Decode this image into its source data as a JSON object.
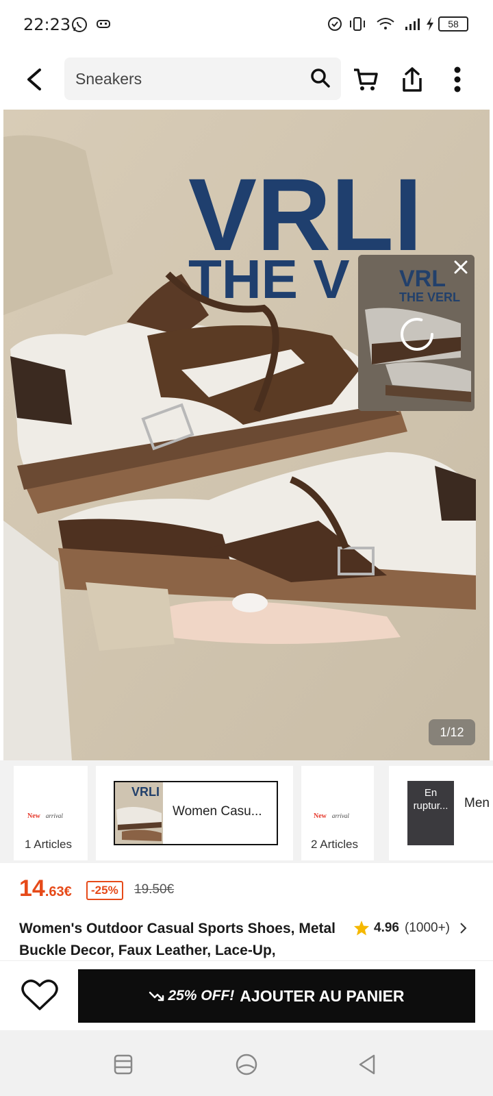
{
  "status_bar": {
    "time": "22:23",
    "battery": "58"
  },
  "header": {
    "search_value": "Sneakers",
    "icons": [
      "back-arrow-icon",
      "search-icon",
      "cart-icon",
      "share-icon",
      "more-vertical-icon"
    ]
  },
  "gallery": {
    "counter": "1/12",
    "shirt_text_line1": "VRLI",
    "shirt_text_line2": "THE V",
    "mini_player_text1": "VRL",
    "mini_player_text2": "THE VERL"
  },
  "variants": [
    {
      "type": "new-arrival",
      "badge_new": "New",
      "badge_arrival": "arrival",
      "label": "1 Articles"
    },
    {
      "type": "selected",
      "title": "Women Casu...",
      "thumb_text": "VRL"
    },
    {
      "type": "new-arrival",
      "badge_new": "New",
      "badge_arrival": "arrival",
      "label": "2 Articles"
    },
    {
      "type": "out-of-stock",
      "status": "En ruptur...",
      "title": "Men"
    }
  ],
  "price": {
    "main_int": "14",
    "main_dec": ".63€",
    "discount": "-25%",
    "old": "19.50€"
  },
  "product": {
    "title": "Women's Outdoor Casual Sports Shoes, Metal Buckle Decor, Faux Leather, Lace-Up,",
    "rating": "4.96",
    "rating_count": "(1000+)"
  },
  "action": {
    "promo": "25% OFF!",
    "add_to_cart": "AJOUTER AU PANIER"
  },
  "colors": {
    "price": "#e64a19",
    "button": "#0d0d0d",
    "star": "#f5b800"
  }
}
